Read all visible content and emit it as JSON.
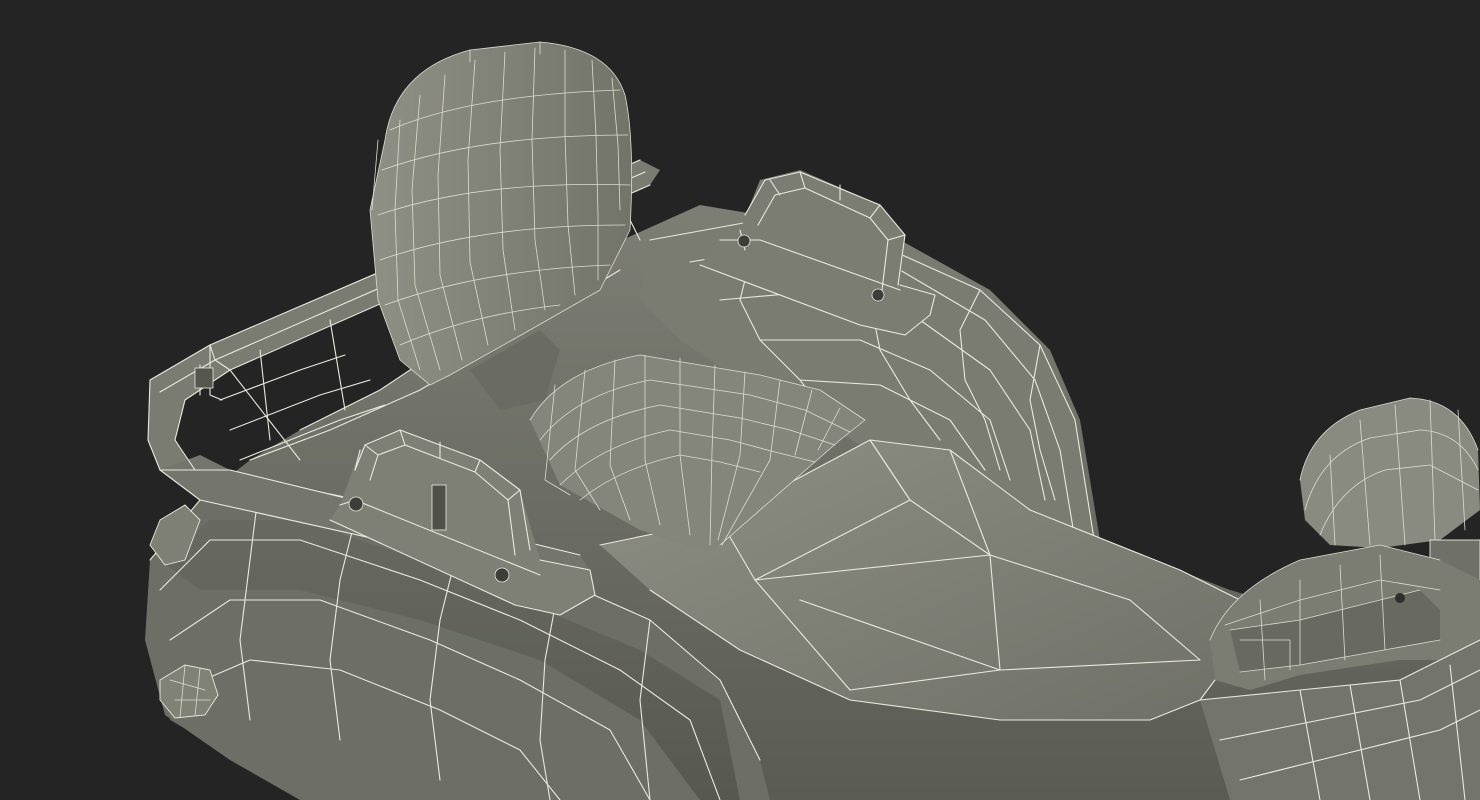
{
  "scene": {
    "subject": "atv-wireframe-render",
    "background_color": "#242424",
    "surface_color_light": "#8a8b80",
    "surface_color_mid": "#707167",
    "surface_color_dark": "#4f5049",
    "wire_color": "#e9e9df",
    "parts": [
      "backrest",
      "rear-rack",
      "left-grab-handle",
      "right-grab-handle",
      "seat-pad",
      "seat",
      "rear-fender",
      "right-fender",
      "right-mirror",
      "handlebar",
      "tail-light"
    ]
  }
}
